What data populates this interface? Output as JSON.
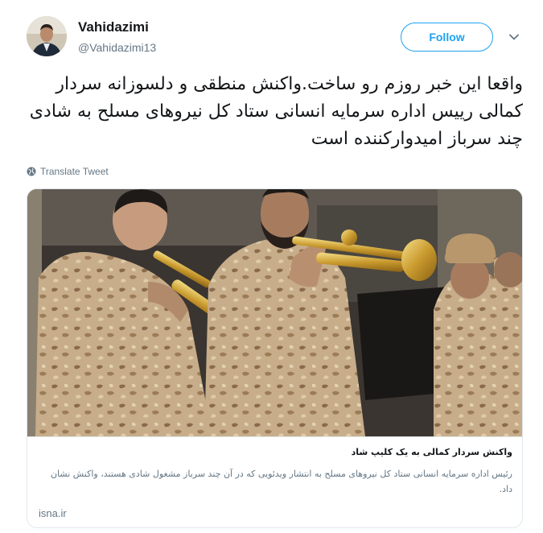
{
  "user": {
    "name": "Vahidazimi",
    "handle": "@Vahidazimi13"
  },
  "follow_label": "Follow",
  "tweet": {
    "text": "واقعا این خبر روزم رو ساخت.واکنش منطقی و دلسوزانه سردار کمالی رییس اداره سرمایه انسانی ستاد کل نیروهای مسلح به شادی چند سرباز امیدوارکننده است"
  },
  "translate_label": "Translate Tweet",
  "card": {
    "title": "واکنش سردار کمالی به یک کلیپ شاد",
    "description": "رئیس اداره سرمایه انسانی ستاد کل نیروهای مسلح به انتشار ویدئویی که در آن چند سرباز مشغول شادی هستند، واکنش نشان داد.",
    "domain": "isna.ir"
  },
  "colors": {
    "accent": "#1da1f2",
    "secondary_text": "#657786",
    "border": "#e1e8ed"
  },
  "icons": {
    "menu": "chevron-down-icon",
    "translate": "globe-icon"
  }
}
